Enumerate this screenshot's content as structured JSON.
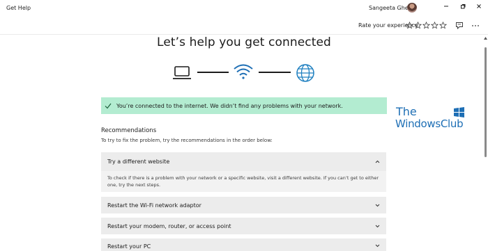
{
  "window": {
    "app_title": "Get Help",
    "user_name": "Sangeeta Ghera",
    "icons": [
      "minimize-icon",
      "maximize-icon",
      "close-icon"
    ]
  },
  "toolbar": {
    "rate_label": "Rate your experience",
    "stars_selected": 0,
    "stars_total": 5,
    "icons": [
      "feedback-icon",
      "more-icon"
    ]
  },
  "main": {
    "headline": "Let’s help you get connected",
    "diagram_icons": [
      "laptop-icon",
      "wifi-icon",
      "globe-icon"
    ],
    "banner": {
      "text": "You’re connected to the internet. We didn’t find any problems with your network.",
      "color": "#b3ecd1",
      "icon": "check-icon"
    },
    "recommendations": {
      "heading": "Recommendations",
      "subtitle": "To try to fix the problem, try the recommendations in the order below:",
      "items": [
        {
          "title": "Try a different website",
          "expanded": true,
          "body": "To check if there is a problem with your network or a specific website, visit a different website. If you can’t get to either one, try the next steps."
        },
        {
          "title": "Restart the Wi-Fi network adaptor",
          "expanded": false
        },
        {
          "title": "Restart your modem, router, or access point",
          "expanded": false
        },
        {
          "title": "Restart your PC",
          "expanded": false
        }
      ]
    }
  },
  "watermark": {
    "line1": "The",
    "line2": "WindowsClub",
    "color": "#1e6fb5"
  }
}
